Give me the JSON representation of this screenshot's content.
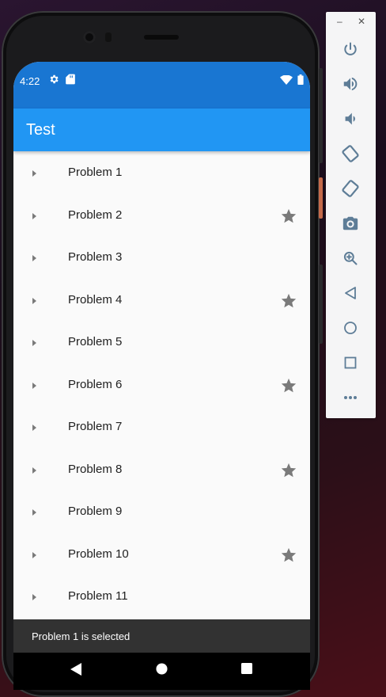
{
  "status_bar": {
    "time": "4:22"
  },
  "app_bar": {
    "title": "Test"
  },
  "problems": [
    {
      "label": "Problem 1",
      "starred": false
    },
    {
      "label": "Problem 2",
      "starred": true
    },
    {
      "label": "Problem 3",
      "starred": false
    },
    {
      "label": "Problem 4",
      "starred": true
    },
    {
      "label": "Problem 5",
      "starred": false
    },
    {
      "label": "Problem 6",
      "starred": true
    },
    {
      "label": "Problem 7",
      "starred": false
    },
    {
      "label": "Problem 8",
      "starred": true
    },
    {
      "label": "Problem 9",
      "starred": false
    },
    {
      "label": "Problem 10",
      "starred": true
    },
    {
      "label": "Problem 11",
      "starred": false
    }
  ],
  "snackbar": {
    "message": "Problem 1 is selected"
  },
  "colors": {
    "status_bar": "#1976d2",
    "app_bar": "#2196f3",
    "star": "#7a7a7a",
    "caret": "#7a7a7a",
    "snackbar": "#323232"
  },
  "emulator_toolbar": {
    "window_controls": [
      "minimize-icon",
      "close-icon"
    ],
    "buttons": [
      "power-icon",
      "volume-up-icon",
      "volume-down-icon",
      "rotate-left-icon",
      "rotate-right-icon",
      "camera-icon",
      "zoom-icon",
      "back-icon",
      "home-icon",
      "overview-icon",
      "more-icon"
    ]
  }
}
